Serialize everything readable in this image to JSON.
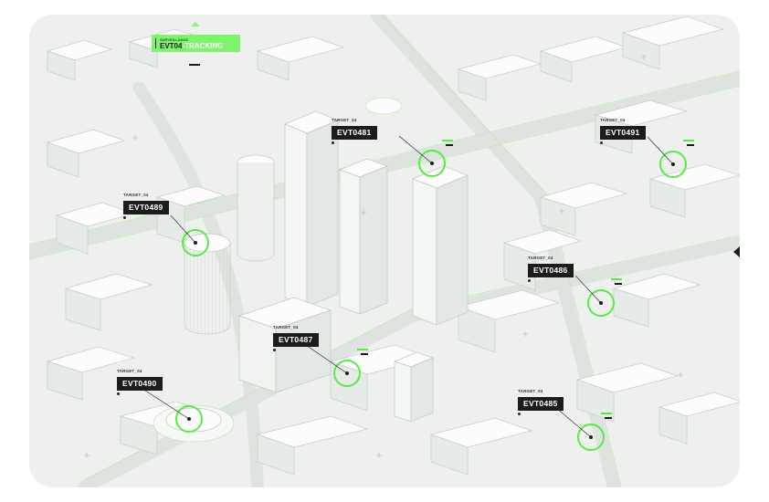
{
  "header": {
    "subtitle": "SURVEILLANCE",
    "event_id": "EVT04",
    "status": "-TRACKING"
  },
  "targets": [
    {
      "category": "TARGET_04",
      "id": "EVT0481"
    },
    {
      "category": "TARGET_04",
      "id": "EVT0491"
    },
    {
      "category": "TARGET_04",
      "id": "EVT0489"
    },
    {
      "category": "TARGET_04",
      "id": "EVT0486"
    },
    {
      "category": "TARGET_04",
      "id": "EVT0487"
    },
    {
      "category": "TARGET_04",
      "id": "EVT0490"
    },
    {
      "category": "TARGET_04",
      "id": "EVT0485"
    }
  ],
  "colors": {
    "accent": "#7ff26e",
    "marker_ring": "#5be84a",
    "label_bg": "#1c1c1c",
    "map_bg": "#eef0ee"
  },
  "icons": {
    "header_caret": "caret-up-icon",
    "side_arrow": "caret-left-icon"
  }
}
